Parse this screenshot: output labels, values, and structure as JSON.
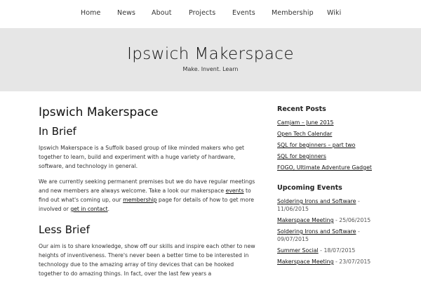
{
  "nav": {
    "items": [
      {
        "label": "Home"
      },
      {
        "label": "News"
      },
      {
        "label": "About"
      },
      {
        "label": "Projects"
      },
      {
        "label": "Events"
      },
      {
        "label": "Membership"
      },
      {
        "label": "Wiki"
      }
    ]
  },
  "header": {
    "title": "Ipswich Makerspace",
    "tagline": "Make. Invent. Learn"
  },
  "main": {
    "page_title": "Ipswich Makerspace",
    "in_brief_heading": "In Brief",
    "p1": "Ipswich Makerspace is a Suffolk based group of like minded makers who get together to learn, build and experiment with a huge variety of hardware, software, and technology in general.",
    "p2_a": "We are currently seeking permanent premises but we do have regular meetings and new members are always welcome. Take a look our makerspace ",
    "p2_link_events": "events",
    "p2_b": " to find out what's coming up, our ",
    "p2_link_membership": "membership",
    "p2_c": " page for details of how to get more involved or ",
    "p2_link_contact": "get in contact",
    "p2_d": ".",
    "less_brief_heading": "Less Brief",
    "p3": "Our aim is to share knowledge, show off our skills and inspire each other to new heights of inventiveness. There's never been a better time to be interested in technology due to the amazing array of tiny devices that can be hooked together to do amazing things. In fact, over the last few years a"
  },
  "sidebar": {
    "recent_heading": "Recent Posts",
    "recent": [
      "Camjam – June 2015",
      "Open Tech Calendar",
      "SQL for beginners – part two",
      "SQL for beginners",
      "FOGO, Ultimate Adventure Gadget"
    ],
    "events_heading": "Upcoming Events",
    "events": [
      {
        "title": "Soldering Irons and Software",
        "date": " - 11/06/2015"
      },
      {
        "title": "Makerspace Meeting",
        "date": " - 25/06/2015"
      },
      {
        "title": "Soldering Irons and Software",
        "date": " - 09/07/2015"
      },
      {
        "title": "Summer Social",
        "date": " - 18/07/2015"
      },
      {
        "title": "Makerspace Meeting",
        "date": " - 23/07/2015"
      }
    ]
  }
}
